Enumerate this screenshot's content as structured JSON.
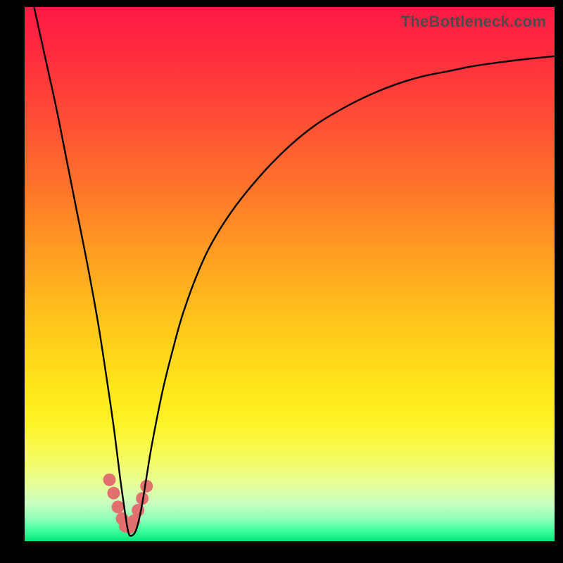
{
  "watermark": "TheBottleneck.com",
  "chart_data": {
    "type": "line",
    "title": "",
    "xlabel": "",
    "ylabel": "",
    "xlim": [
      0,
      100
    ],
    "ylim": [
      0,
      100
    ],
    "grid": false,
    "series": [
      {
        "name": "bottleneck-curve",
        "x": [
          0,
          2,
          4,
          6,
          8,
          10,
          12,
          14,
          16,
          17,
          18,
          19,
          19.5,
          20,
          21,
          22,
          23,
          24,
          26,
          28,
          30,
          33,
          36,
          40,
          45,
          50,
          55,
          60,
          65,
          70,
          75,
          80,
          85,
          90,
          95,
          100
        ],
        "values": [
          108,
          99,
          90,
          81,
          71,
          61,
          51,
          40,
          27,
          20,
          12,
          5,
          2,
          1,
          2,
          6,
          12,
          18,
          28,
          36,
          43,
          51,
          57,
          63,
          69,
          74,
          78,
          81,
          83.5,
          85.5,
          87,
          88,
          89,
          89.7,
          90.3,
          90.8
        ]
      }
    ],
    "markers": {
      "name": "highlight-dots",
      "color": "#e2706f",
      "radius_px": 9,
      "x": [
        16.0,
        16.8,
        17.6,
        18.4,
        19.0,
        19.8,
        20.6,
        21.4,
        22.2,
        23.0
      ],
      "values": [
        11.5,
        9.0,
        6.4,
        4.2,
        2.8,
        2.6,
        3.8,
        5.8,
        8.0,
        10.3
      ]
    }
  }
}
